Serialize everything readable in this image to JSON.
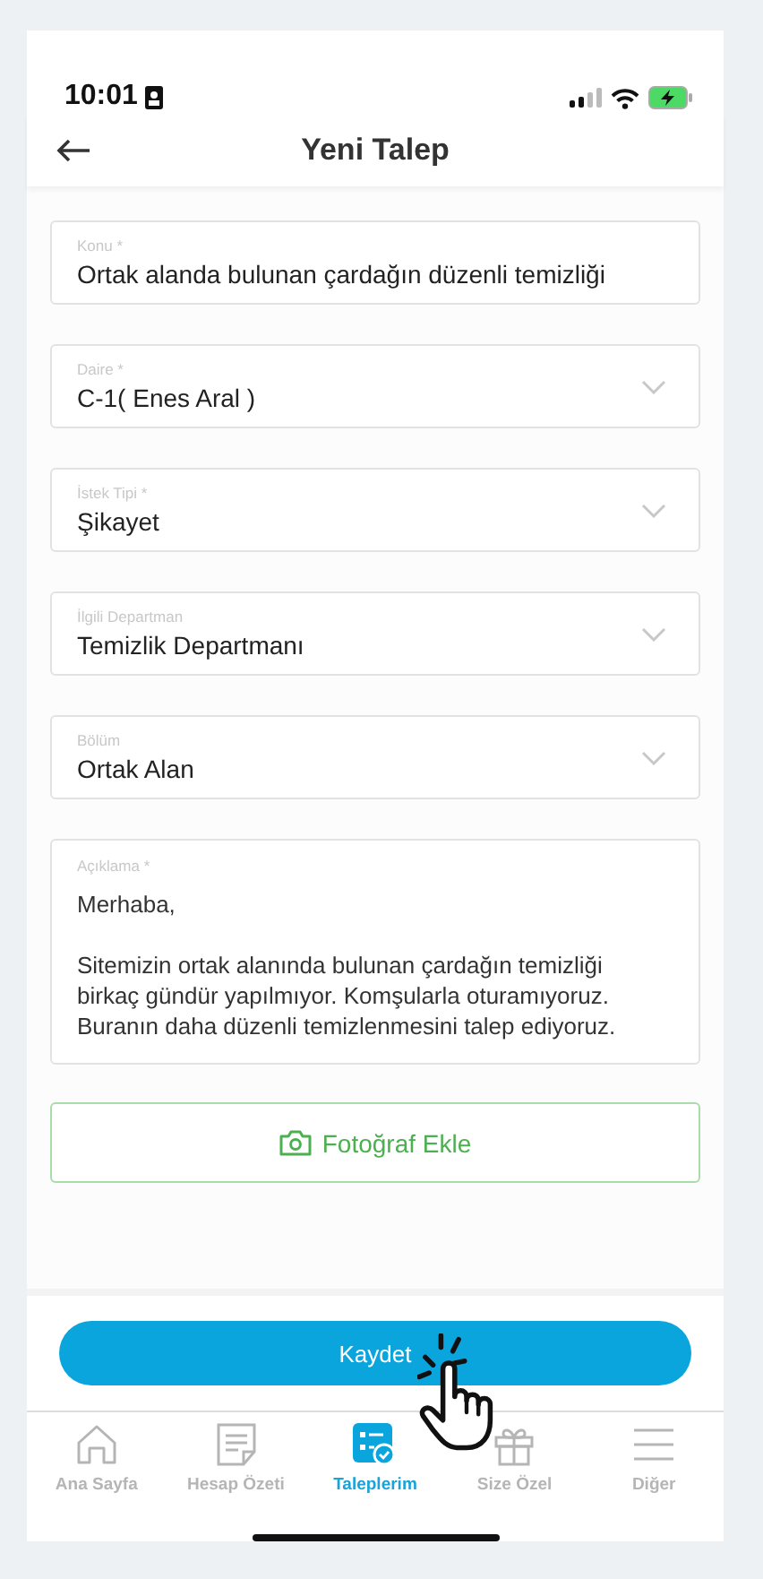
{
  "status_bar": {
    "time": "10:01"
  },
  "header": {
    "title": "Yeni Talep"
  },
  "fields": [
    {
      "kind": "text",
      "label": "Konu *",
      "value": "Ortak alanda bulunan çardağın düzenli temizliği"
    },
    {
      "kind": "select",
      "label": "Daire *",
      "value": "C-1( Enes Aral )"
    },
    {
      "kind": "select",
      "label": "İstek Tipi *",
      "value": "Şikayet"
    },
    {
      "kind": "select",
      "label": "İlgili Departman",
      "value": "Temizlik Departmanı"
    },
    {
      "kind": "select",
      "label": "Bölüm",
      "value": "Ortak Alan"
    }
  ],
  "description": {
    "label": "Açıklama *",
    "paragraphs": [
      "Merhaba,",
      "Sitemizin ortak alanında bulunan çardağın temizliği birkaç gündür yapılmıyor. Komşularla oturamıyoruz. Buranın daha düzenli temizlenmesini talep ediyoruz."
    ]
  },
  "photo_button": {
    "label": "Fotoğraf Ekle"
  },
  "save_button": {
    "label": "Kaydet"
  },
  "tabs": [
    {
      "kind": "home",
      "label": "Ana Sayfa",
      "selected": false
    },
    {
      "kind": "summary",
      "label": "Hesap Özeti",
      "selected": false
    },
    {
      "kind": "requests",
      "label": "Taleplerim",
      "selected": true
    },
    {
      "kind": "gift",
      "label": "Size Özel",
      "selected": false
    },
    {
      "kind": "menu",
      "label": "Diğer",
      "selected": false
    }
  ]
}
